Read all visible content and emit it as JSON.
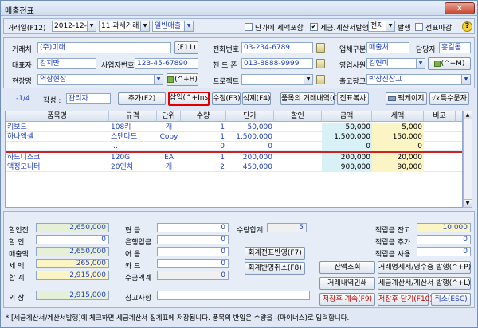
{
  "window": {
    "title": "매출전표"
  },
  "topbar": {
    "date_label": "거래일(F12)",
    "date_value": "2012-12-26",
    "tax_type": "11 과세거래",
    "sale_type": "일반매출",
    "unit_price_tax_label": "단가에 세액포함",
    "tax_invoice_label": "세금.계산서발행",
    "tax_invoice_checked": "✔",
    "issue_method": "전자",
    "issue_label": "발행",
    "closing_label": "전표마감",
    "help": "?"
  },
  "header": {
    "customer_label": "거래처",
    "customer_value": "(주)미래",
    "customer_btn": "(F11)",
    "rep_label": "대표자",
    "rep_value": "강지만",
    "bizno_label": "사업자번호",
    "bizno_value": "123-45-67890",
    "site_label": "현장명",
    "site_value": "역삼현장",
    "site_btn": "(^+H)",
    "phone_label": "전화번호",
    "phone_value": "03-234-6789",
    "mobile_label": "핸 드 폰",
    "mobile_value": "013-8888-9999",
    "project_label": "프로젝트",
    "project_value": "",
    "biz_type_label": "업체구분",
    "biz_type_value": "매출처",
    "manager_label": "담당자",
    "manager_value": "홍길동",
    "sales_rep_label": "영업사원",
    "sales_rep_value": "김현미",
    "sales_rep_btn": "(^+M)",
    "warehouse_label": "출고창고",
    "warehouse_value": "박상진창고"
  },
  "toolbar": {
    "page": "-1/4",
    "writer_label": "작성 :",
    "writer_value": "관리자",
    "add": "추가(F2)",
    "insert": "삽입(^+Ins)",
    "edit": "수정(F3)",
    "delete": "삭제(F4)",
    "history": "품목의 거래내역(Ctrl+B)",
    "copy": "전표복사",
    "package": "팩케이지",
    "special": "특수문자"
  },
  "table": {
    "columns": [
      "품목명",
      "규격",
      "단위",
      "수량",
      "단가",
      "할인",
      "금액",
      "세액",
      "비고"
    ],
    "rows": [
      {
        "name": "키보드",
        "spec": "108키",
        "unit": "개",
        "qty": "1",
        "price": "50,000",
        "disc": "",
        "amount": "50,000",
        "tax": "5,000",
        "note": ""
      },
      {
        "name": "하나엑셀",
        "spec": "스탠다드",
        "unit": "Copy",
        "qty": "1",
        "price": "1,500,000",
        "disc": "",
        "amount": "1,500,000",
        "tax": "150,000",
        "note": ""
      },
      {
        "name": "",
        "spec": "…",
        "unit": "",
        "qty": "0",
        "price": "0",
        "disc": "",
        "amount": "0",
        "tax": "0",
        "note": ""
      },
      {
        "name": "하드디스크",
        "spec": "120G",
        "unit": "EA",
        "qty": "1",
        "price": "200,000",
        "disc": "",
        "amount": "200,000",
        "tax": "20,000",
        "note": ""
      },
      {
        "name": "액정모니터",
        "spec": "20인치",
        "unit": "개",
        "qty": "2",
        "price": "450,000",
        "disc": "",
        "amount": "900,000",
        "tax": "90,000",
        "note": ""
      }
    ]
  },
  "summary": {
    "pre_disc_label": "할인전",
    "pre_disc": "2,650,000",
    "disc_label": "할  인",
    "disc": "0",
    "sales_label": "매출액",
    "sales": "2,650,000",
    "tax_label": "세  액",
    "tax": "265,000",
    "total_label": "합  계",
    "total": "2,915,000",
    "credit_label": "외  상",
    "credit": "2,915,000",
    "cash_label": "현  금",
    "cash": "0",
    "bank_label": "은행입금",
    "bank": "0",
    "bill_label": "어  음",
    "bill": "0",
    "card_label": "카  드",
    "card": "0",
    "collect_label": "수금액계",
    "collect": "0",
    "qty_total_label": "수량합계",
    "qty_total": "5",
    "ref_label": "참고사항",
    "ref": "",
    "reserve_bal_label": "적립금 잔고",
    "reserve_bal": "10,000",
    "reserve_add_label": "적립금 추가",
    "reserve_add": "0",
    "reserve_use_label": "적립금 사용",
    "reserve_use": "0"
  },
  "actions": {
    "acct_apply": "회계전표반영(F7)",
    "acct_cancel": "회계반영취소(F8)",
    "balance": "잔액조회",
    "statement": "거래명세서/영수증 발행(^+P)",
    "print_history": "거래내역인쇄",
    "tax_invoice": "세금계산서/계산서 발행(^+L)",
    "save_continue": "저장후 계속(F9)",
    "save_close": "저장후 닫기(F10)",
    "cancel": "취소(ESC)"
  },
  "status": {
    "text": "* [세금계산서/계산서발행]에 체크하면 세금계산서 집계표에 저장됩니다.   품목의 반입은 수량을 -(마이너스)로 입력합니다."
  }
}
